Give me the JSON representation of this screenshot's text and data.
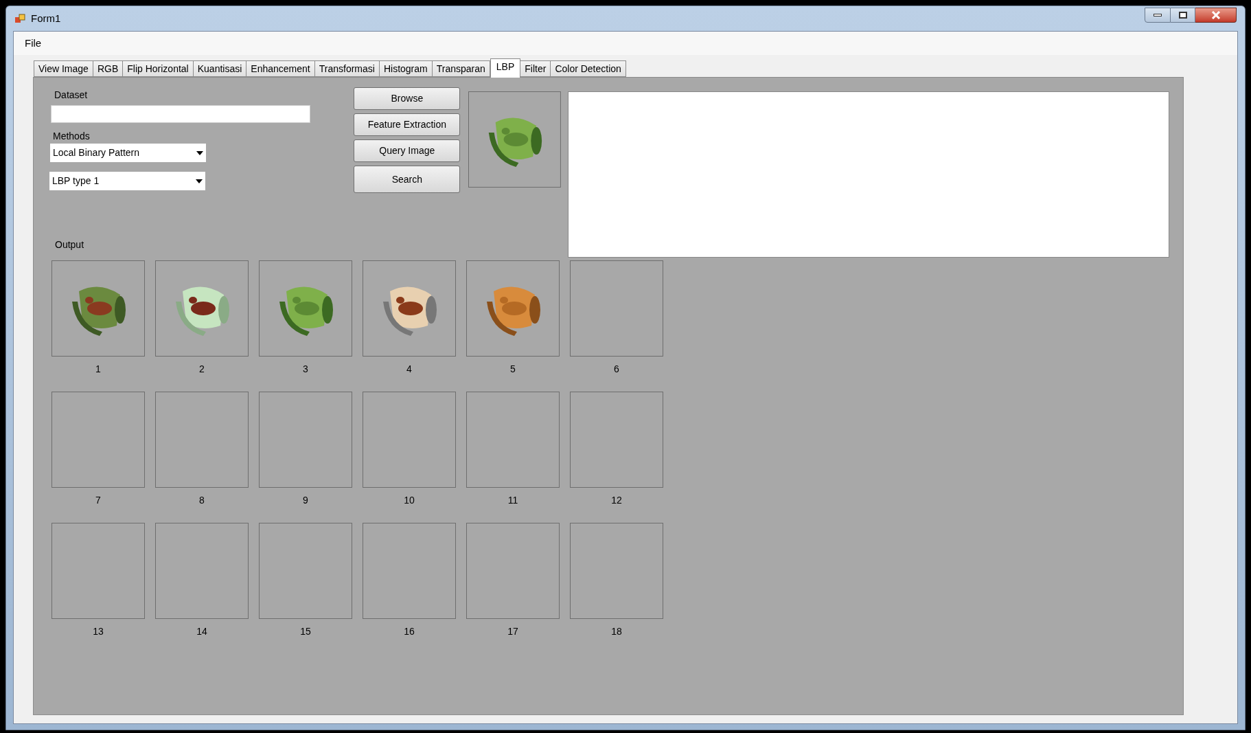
{
  "window": {
    "title": "Form1"
  },
  "menu": [
    "File"
  ],
  "tabs": [
    {
      "label": "View Image",
      "selected": false
    },
    {
      "label": "RGB",
      "selected": false
    },
    {
      "label": "Flip Horizontal",
      "selected": false
    },
    {
      "label": "Kuantisasi",
      "selected": false
    },
    {
      "label": "Enhancement",
      "selected": false
    },
    {
      "label": "Transformasi",
      "selected": false
    },
    {
      "label": "Histogram",
      "selected": false
    },
    {
      "label": "Transparan",
      "selected": false
    },
    {
      "label": "LBP",
      "selected": true
    },
    {
      "label": "Filter",
      "selected": false
    },
    {
      "label": "Color Detection",
      "selected": false
    }
  ],
  "dataset": {
    "label": "Dataset"
  },
  "methods": {
    "label": "Methods",
    "method": "Local Binary Pattern",
    "type": "LBP type 1"
  },
  "buttons": [
    "Browse",
    "Feature Extraction",
    "Query Image",
    "Search"
  ],
  "output": {
    "label": "Output",
    "results": [
      {
        "label": "1",
        "kind": "picture"
      },
      {
        "label": "2",
        "kind": "picture"
      },
      {
        "label": "3",
        "kind": "picture"
      },
      {
        "label": "4",
        "kind": "picture"
      },
      {
        "label": "5",
        "kind": "picture"
      },
      {
        "label": "6",
        "kind": "empty"
      },
      {
        "label": "7",
        "kind": "empty"
      },
      {
        "label": "8",
        "kind": "empty"
      },
      {
        "label": "9",
        "kind": "empty"
      },
      {
        "label": "10",
        "kind": "empty"
      },
      {
        "label": "11",
        "kind": "empty"
      },
      {
        "label": "12",
        "kind": "empty"
      },
      {
        "label": "13",
        "kind": "empty"
      },
      {
        "label": "14",
        "kind": "empty"
      },
      {
        "label": "15",
        "kind": "empty"
      },
      {
        "label": "16",
        "kind": "empty"
      },
      {
        "label": "17",
        "kind": "empty"
      },
      {
        "label": "18",
        "kind": "empty"
      }
    ]
  }
}
